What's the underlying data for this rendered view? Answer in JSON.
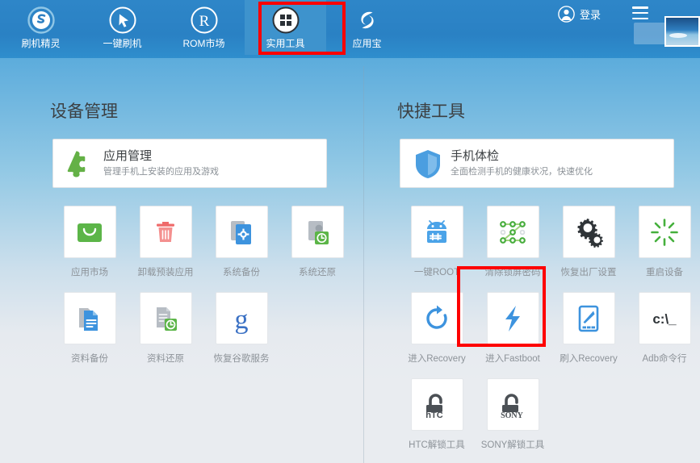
{
  "app": {
    "accent_blue": "#2a81c4",
    "highlight_red": "#fe0000"
  },
  "header": {
    "nav": [
      {
        "label": "刷机精灵",
        "icon": "shuaji-s-logo-icon",
        "active": false
      },
      {
        "label": "一键刷机",
        "icon": "cursor-circle-icon",
        "active": false
      },
      {
        "label": "ROM市场",
        "icon": "registered-r-icon",
        "active": false
      },
      {
        "label": "实用工具",
        "icon": "grid-squares-icon",
        "active": true
      },
      {
        "label": "应用宝",
        "icon": "yingyongbao-swirl-icon",
        "active": false
      }
    ],
    "login_label": "登录",
    "login_icon": "avatar-circle-icon",
    "menu_icon": "hamburger-menu-icon",
    "minimize_icon": "minimize-icon",
    "download_icon": "download-arrow-icon",
    "thumbnail_name": "wallpaper-thumbnail"
  },
  "left_panel": {
    "title": "设备管理",
    "card": {
      "title": "应用管理",
      "subtitle": "管理手机上安装的应用及游戏",
      "icon": "puzzle-piece-icon"
    },
    "tiles": [
      {
        "label": "应用市场",
        "icon": "shopping-bag-icon"
      },
      {
        "label": "卸载预装应用",
        "icon": "trash-can-icon"
      },
      {
        "label": "系统备份",
        "icon": "system-backup-gear-icon"
      },
      {
        "label": "系统还原",
        "icon": "system-restore-clock-icon"
      },
      {
        "label": "资料备份",
        "icon": "document-backup-icon"
      },
      {
        "label": "资料还原",
        "icon": "document-restore-clock-icon"
      },
      {
        "label": "恢复谷歌服务",
        "icon": "google-g-icon"
      }
    ]
  },
  "right_panel": {
    "title": "快捷工具",
    "card": {
      "title": "手机体检",
      "subtitle": "全面检测手机的健康状况，快速优化",
      "icon": "shield-icon"
    },
    "tiles": [
      {
        "label": "一键ROOT",
        "icon": "android-root-icon",
        "highlighted": false
      },
      {
        "label": "清除锁屏密码",
        "icon": "pattern-lock-icon",
        "highlighted": true
      },
      {
        "label": "恢复出厂设置",
        "icon": "gears-icon",
        "highlighted": false
      },
      {
        "label": "重启设备",
        "icon": "restart-burst-icon",
        "highlighted": false
      },
      {
        "label": "进入Recovery",
        "icon": "refresh-arrow-icon",
        "highlighted": false
      },
      {
        "label": "进入Fastboot",
        "icon": "lightning-bolt-icon",
        "highlighted": false
      },
      {
        "label": "刷入Recovery",
        "icon": "phone-pencil-icon",
        "highlighted": false
      },
      {
        "label": "Adb命令行",
        "icon": "command-prompt-icon",
        "highlighted": false
      },
      {
        "label": "HTC解锁工具",
        "icon": "htc-unlock-padlock-icon",
        "highlighted": false
      },
      {
        "label": "SONY解锁工具",
        "icon": "sony-unlock-padlock-icon",
        "highlighted": false
      }
    ]
  }
}
